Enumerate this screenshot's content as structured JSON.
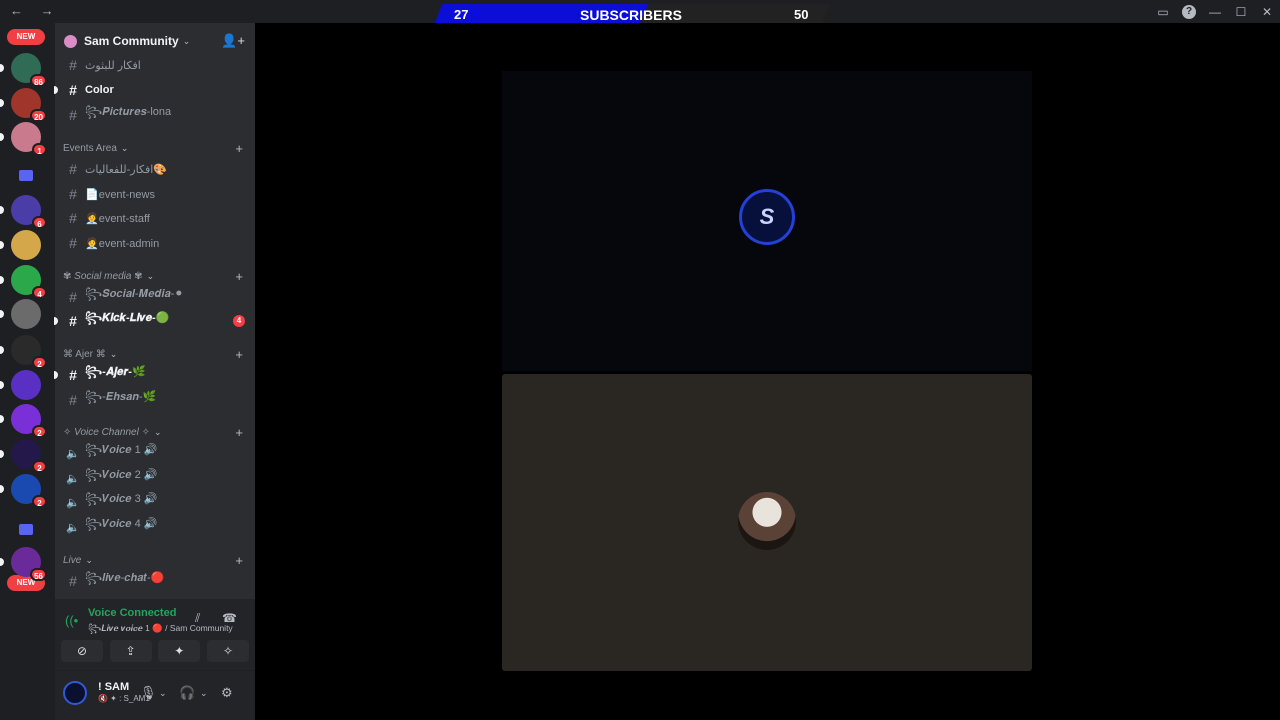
{
  "titlebar": {
    "back": "←",
    "forward": "→",
    "subscribers": {
      "current": "27",
      "label": "SUBSCRIBERS",
      "goal": "50",
      "progress": 0.54
    },
    "controls": {
      "screen": "▭",
      "help": "?",
      "minimize": "—",
      "maximize": "☐",
      "close": "✕"
    }
  },
  "servers": [
    {
      "badge": "86",
      "color": "#2f6b55"
    },
    {
      "badge": "20",
      "color": "#a0352b"
    },
    {
      "badge": "1",
      "color": "#c97a8c"
    },
    {
      "badge": "6",
      "color": "#4a3da8"
    },
    {
      "badge": "",
      "color": "#d4a84a"
    },
    {
      "badge": "4",
      "color": "#2ba84a"
    },
    {
      "badge": "",
      "color": "#6b6b6b"
    },
    {
      "badge": "2",
      "color": "#2a2a2a"
    },
    {
      "badge": "",
      "color": "#5a2fc4"
    },
    {
      "badge": "2",
      "color": "#7b2fd6"
    },
    {
      "badge": "2",
      "color": "#24184a"
    },
    {
      "badge": "2",
      "color": "#1a4ab0"
    },
    {
      "badge": "56",
      "color": "#6a2a9a"
    }
  ],
  "new_pill": "NEW",
  "guild": {
    "name": "Sam Community",
    "chevron": "⌄",
    "invite_icon": "👤+"
  },
  "channels": {
    "top": [
      {
        "name": "افكار للبثوث",
        "unread": false,
        "italic": false
      },
      {
        "name": "Color",
        "unread": true,
        "italic": false
      },
      {
        "name": "꧂𝑷𝒊𝒄𝒕𝒖𝒓𝒆𝒔-lona",
        "unread": false,
        "italic": false
      }
    ],
    "events_category": "Events Area",
    "events": [
      {
        "name": "افكار-للفعاليات🎨"
      },
      {
        "name": "📄event-news"
      },
      {
        "name": "🧑‍💼event-staff"
      },
      {
        "name": "🧑‍💼event-admin"
      }
    ],
    "social_category": "✾ Social media ✾",
    "social": [
      {
        "name": "꧂𝑺𝒐𝒄𝒊𝒂𝒍-𝑴𝒆𝒅𝒊𝒂-⚫",
        "unread": false
      },
      {
        "name": "꧂𝑲𝒊𝒄𝒌-𝑳𝒊𝒗𝒆-🟢",
        "unread": true,
        "mention": "4"
      }
    ],
    "ajer_category": "⌘ Ajer ⌘",
    "ajer": [
      {
        "name": "꧂-𝑨𝒋𝒆𝒓-🌿",
        "unread": true
      },
      {
        "name": "꧂-𝑬𝒉𝒔𝒂𝒏-🌿",
        "unread": false
      }
    ],
    "voice_category": "✧ Voice Channel ✧",
    "voice": [
      {
        "name": "꧂𝑽𝒐𝒊𝒄𝒆 1 🔊"
      },
      {
        "name": "꧂𝑽𝒐𝒊𝒄𝒆 2 🔊"
      },
      {
        "name": "꧂𝑽𝒐𝒊𝒄𝒆 3 🔊"
      },
      {
        "name": "꧂𝑽𝒐𝒊𝒄𝒆 4 🔊"
      }
    ],
    "live_category": "Live",
    "live": [
      {
        "name": "꧂𝒍𝒊𝒗𝒆-𝒄𝒉𝒂𝒕-🔴"
      }
    ],
    "hash": "#",
    "plus": "+",
    "speaker": "🔈"
  },
  "voice_panel": {
    "title": "Voice Connected",
    "subtitle": "꧂𝑳𝒊𝒗𝒆 𝒗𝒐𝒊𝒄𝒆 1 🔴 / Sam Community",
    "signal_icon": "((•",
    "noise_icon": "⫽",
    "disconnect_icon": "☎",
    "buttons": [
      "⊘",
      "⇪",
      "✦",
      "✧"
    ]
  },
  "user": {
    "name": "! SAM",
    "status": "🔇 ✦ : S_AM1",
    "mic": "🎙",
    "headset": "🎧",
    "settings": "⚙",
    "caret": "⌄"
  },
  "stage": {
    "tile1_avatar_text": "S"
  }
}
